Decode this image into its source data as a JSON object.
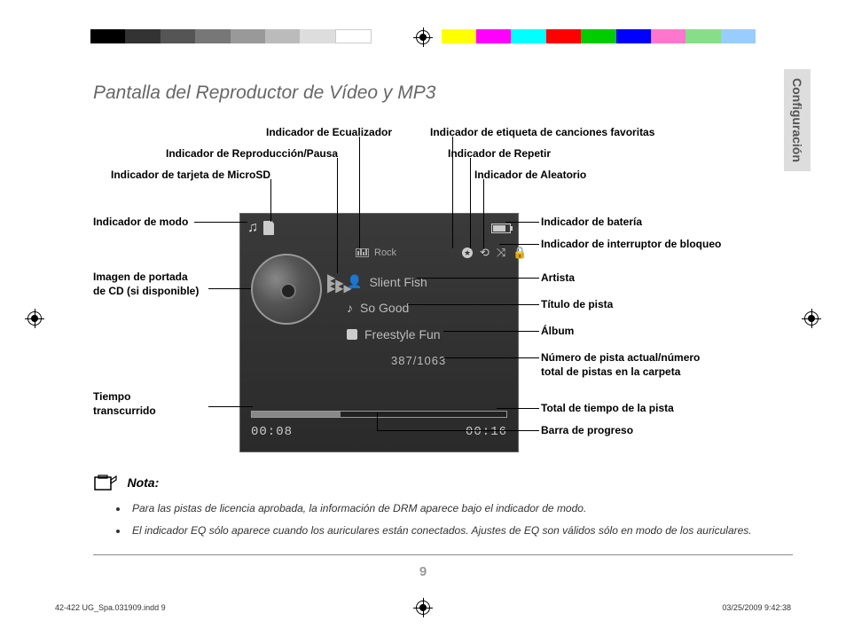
{
  "page_title": "Pantalla del Reproductor de Vídeo y MP3",
  "side_tab": "Configuración",
  "labels": {
    "eq": "Indicador de Ecualizador",
    "fav": "Indicador de etiqueta de canciones favoritas",
    "playpause": "Indicador de Reproducción/Pausa",
    "repeat": "Indicador de Repetir",
    "microsd": "Indicador de tarjeta de MicroSD",
    "shuffle": "Indicador de Aleatorio",
    "mode": "Indicador de modo",
    "battery": "Indicador de batería",
    "lock": "Indicador de interruptor de bloqueo",
    "cover": "Imagen de portada\nde CD (si disponible)",
    "artist": "Artista",
    "title": "Título de pista",
    "album": "Álbum",
    "tracknum": "Número de pista actual/número\ntotal de pistas en la carpeta",
    "elapsed": "Tiempo\ntranscurrido",
    "totaltime": "Total de tiempo de la pista",
    "progress": "Barra de progreso"
  },
  "screen": {
    "eq_text": "Rock",
    "artist": "Slient Fish",
    "title": "So Good",
    "album": "Freestyle Fun",
    "track_number": "387/1063",
    "time_elapsed": "00:08",
    "time_total": "00:16"
  },
  "note": {
    "heading": "Nota:",
    "items": [
      "Para las pistas de licencia aprobada, la información de DRM aparece bajo el indicador de modo.",
      "El indicador EQ sólo aparece cuando los auriculares están conectados. Ajustes de EQ son válidos sólo en modo de los auriculares."
    ]
  },
  "page_number": "9",
  "imprint_left": "42-422 UG_Spa.031909.indd   9",
  "imprint_right": "03/25/2009   9:42:38",
  "color_bar": [
    "#000",
    "#333",
    "#555",
    "#777",
    "#999",
    "#bbb",
    "#ddd",
    "#fff",
    "",
    "#ff0",
    "#f0f",
    "#0ff",
    "#f00",
    "#0c0",
    "#00f",
    "#f6c",
    "#7c7",
    "#9cf"
  ]
}
